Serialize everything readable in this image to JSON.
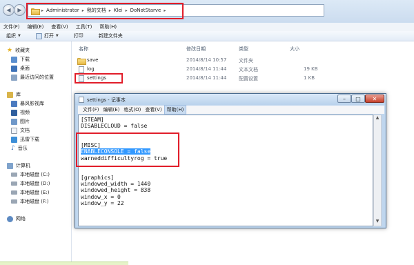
{
  "address_bar": {
    "crumbs": [
      "Administrator",
      "我的文档",
      "Klei",
      "DoNotStarve"
    ]
  },
  "menubar": [
    "文件(F)",
    "编辑(E)",
    "查看(V)",
    "工具(T)",
    "帮助(H)"
  ],
  "toolbar": {
    "organize": "组织",
    "open": "打开",
    "print": "打印",
    "new_folder": "新建文件夹"
  },
  "sidebar": {
    "favorites": "收藏夹",
    "downloads": "下载",
    "desktop": "桌面",
    "recent": "最近访问的位置",
    "libraries": "库",
    "storm_video": "暴风影视库",
    "videos": "视频",
    "pictures": "图片",
    "documents": "文档",
    "xunlei": "迅雷下载",
    "music": "音乐",
    "computer": "计算机",
    "disk_c": "本地磁盘 (C:)",
    "disk_d": "本地磁盘 (D:)",
    "disk_e": "本地磁盘 (E:)",
    "disk_f": "本地磁盘 (F:)",
    "network": "网络"
  },
  "columns": {
    "name": "名称",
    "modified": "修改日期",
    "type": "类型",
    "size": "大小"
  },
  "files": [
    {
      "name": "save",
      "modified": "2014/8/14 10:57",
      "type": "文件夹",
      "size": ""
    },
    {
      "name": "log",
      "modified": "2014/8/14 11:44",
      "type": "文本文档",
      "size": "19 KB"
    },
    {
      "name": "settings",
      "modified": "2014/8/14 11:44",
      "type": "配置设置",
      "size": "1 KB"
    }
  ],
  "notepad": {
    "title": "settings - 记事本",
    "menu": [
      "文件(F)",
      "编辑(E)",
      "格式(O)",
      "查看(V)",
      "帮助(H)"
    ],
    "lines": {
      "l1": "[STEAM]",
      "l2": "DISABLECLOUD = false",
      "l3": "[MISC]",
      "l4": "ENABLECONSOLE = false",
      "l5": "warneddifficultyrog = true",
      "l6": "[graphics]",
      "l7": "windowed_width = 1440",
      "l8": "windowed_height = 838",
      "l9": "window_x = 0",
      "l10": "window_y = 22"
    }
  },
  "colors": {
    "highlight_box": "#e11d2a",
    "selection": "#3399ff"
  }
}
